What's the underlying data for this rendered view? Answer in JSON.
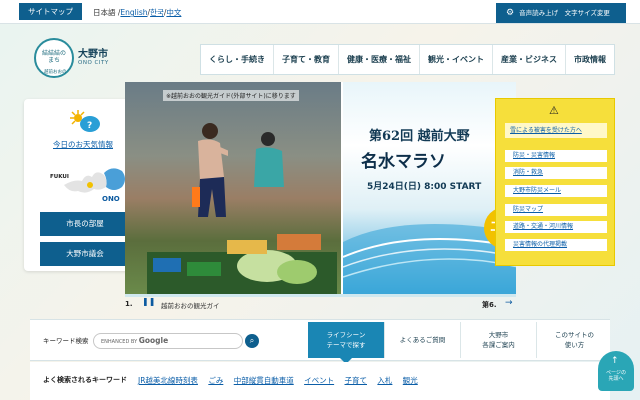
{
  "topbar": {
    "sitemap": "サイトマップ",
    "lang_ja": "日本語",
    "lang_en": "English",
    "lang_ko": "한국",
    "lang_zh": "中文",
    "voice": "音声読み上げ　文字サイズ変更"
  },
  "header": {
    "logo_text": "結結結のまち",
    "logo_sub": "越前おおの",
    "city_name": "大野市",
    "city_en": "ONO CITY",
    "nav": [
      "くらし・手続き",
      "子育て・教育",
      "健康・医療・福祉",
      "観光・イベント",
      "産業・ビジネス",
      "市政情報"
    ]
  },
  "left_panel": {
    "weather": "今日のお天気情報",
    "map_fukui": "FUKUI",
    "map_ono": "ONO",
    "mayor": "市長の部屋",
    "council": "大野市議会"
  },
  "slider": {
    "caption_a": "※越前おおの観光ガイド(外部サイト)に移ります",
    "title_b1": "第62回 越前大野",
    "title_b2": "名水マラソ",
    "date_b": "5月24日(日) 8:00 START",
    "entry_b": "エ",
    "label_a": "1.",
    "label_a2": "越前おおの観光ガイ",
    "label_b": "第6."
  },
  "disaster": {
    "head": "雪による被害を受けた方へ",
    "items": [
      "防災・災害情報",
      "消防・救急",
      "大野市防災メール",
      "防災マップ",
      "道路・交通・河川情報",
      "災害情報の代理掲載"
    ]
  },
  "search": {
    "label": "キーワード検索",
    "powered": "ENHANCED BY",
    "google": "Google"
  },
  "tabs": {
    "life_line1": "ライフシーン",
    "life_line2": "テーマで探す",
    "faq": "よくあるご質問",
    "guide_line1": "大野市",
    "guide_line2": "各課ご案内",
    "howto_line1": "このサイトの",
    "howto_line2": "使い方"
  },
  "freq": {
    "label": "よく検索されるキーワード",
    "links": [
      "JR越美北線時刻表",
      "ごみ",
      "中部縦貫自動車道",
      "イベント",
      "子育て",
      "入札",
      "観光"
    ]
  },
  "pagetop": {
    "line1": "ページの",
    "line2": "先頭へ"
  },
  "colors": {
    "brand_blue": "#0e5f8e",
    "accent_teal": "#1a86b4",
    "disaster_yellow": "#f6df3b",
    "link_blue": "#0b5ea8"
  }
}
